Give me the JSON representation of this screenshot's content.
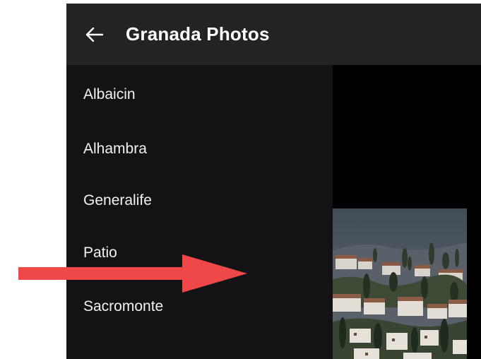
{
  "app_bar": {
    "title": "Granada Photos",
    "back_icon": "arrow-left-icon"
  },
  "drawer": {
    "items": [
      {
        "label": "Albaicin"
      },
      {
        "label": "Alhambra"
      },
      {
        "label": "Generalife"
      },
      {
        "label": "Patio"
      },
      {
        "label": "Sacromonte"
      }
    ]
  },
  "content": {
    "photo_subject": "hillside-town-photo"
  },
  "colors": {
    "app_bar_bg": "#232323",
    "drawer_bg": "#141215",
    "content_bg": "#000000",
    "annotation_arrow": "#f04848"
  }
}
